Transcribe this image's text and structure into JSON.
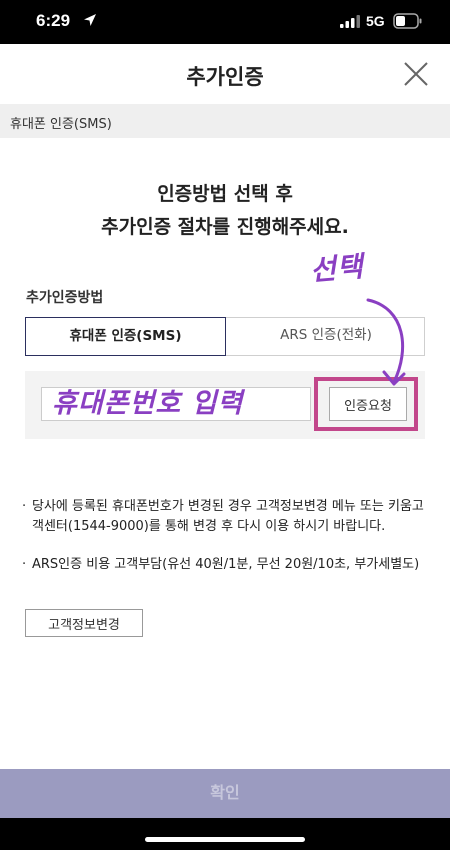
{
  "status_bar": {
    "time": "6:29",
    "network": "5G"
  },
  "header": {
    "title": "추가인증"
  },
  "section": {
    "label": "휴대폰 인증(SMS)"
  },
  "headline": {
    "line1": "인증방법 선택 후",
    "line2": "추가인증 절차를 진행해주세요."
  },
  "method": {
    "label": "추가인증방법",
    "tabs": [
      {
        "label": "휴대폰 인증(SMS)",
        "selected": true
      },
      {
        "label": "ARS 인증(전화)",
        "selected": false
      }
    ]
  },
  "phone": {
    "value": "",
    "request_label": "인증요청"
  },
  "annotations": {
    "select": "선택",
    "phone_input": "휴대폰번호 입력",
    "color": "#8a3fc2",
    "box_color": "#c2478b"
  },
  "notices": [
    "당사에 등록된 휴대폰번호가 변경된 경우 고객정보변경 메뉴 또는 키움고객센터(1544-9000)를 통해 변경 후 다시 이용 하시기 바랍니다.",
    "ARS인증 비용 고객부담(유선 40원/1분, 무선 20원/10초, 부가세별도)"
  ],
  "notice_bullet": "·",
  "buttons": {
    "info_change": "고객정보변경",
    "confirm": "확인"
  },
  "colors": {
    "accent": "#2b2f5e",
    "confirm_bg": "#9b9bc0"
  },
  "icons": {
    "location": "location-arrow-icon",
    "signal": "cell-signal-icon",
    "battery": "battery-icon",
    "close": "close-icon"
  }
}
